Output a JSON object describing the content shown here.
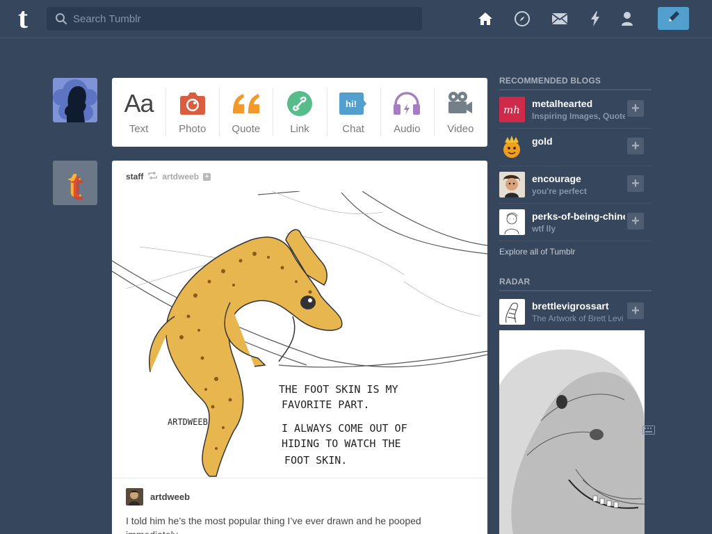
{
  "header": {
    "logo_letter": "t",
    "search_placeholder": "Search Tumblr",
    "nav_icons": [
      "home-icon",
      "explore-compass-icon",
      "inbox-envelope-icon",
      "activity-lightning-icon",
      "account-person-icon"
    ],
    "compose_icon": "pencil-icon"
  },
  "post_types": [
    {
      "label": "Text",
      "icon": "Aa",
      "color": "#444444"
    },
    {
      "label": "Photo",
      "icon": "camera-icon",
      "color": "#d95e40"
    },
    {
      "label": "Quote",
      "icon": "quote-icon",
      "color": "#f2992e"
    },
    {
      "label": "Link",
      "icon": "link-icon",
      "color": "#56bc8a"
    },
    {
      "label": "Chat",
      "icon": "chat-icon",
      "color": "#529ecc",
      "icon_text": "hi!"
    },
    {
      "label": "Audio",
      "icon": "headphones-icon",
      "color": "#a77dc2"
    },
    {
      "label": "Video",
      "icon": "video-camera-icon",
      "color": "#748089"
    }
  ],
  "post": {
    "user": "staff",
    "reblogged_from": "artdweeb",
    "image_caption_lines": [
      "THE FOOT SKIN IS MY",
      "FAVORITE PART.",
      "I ALWAYS COME OUT OF",
      "HIDING TO WATCH THE",
      "FOOT SKIN."
    ],
    "image_signature": "ARTDWEEB",
    "caption_user": "artdweeb",
    "caption_text": "I told him he’s the most popular thing I’ve ever drawn and he pooped immediately."
  },
  "sidebar": {
    "recommended_title": "Recommended Blogs",
    "blogs": [
      {
        "name": "metalhearted",
        "subtitle": "Inspiring Images, Quotes",
        "avatar_text": "mh"
      },
      {
        "name": "gold",
        "subtitle": ""
      },
      {
        "name": "encourage",
        "subtitle": "you're perfect"
      },
      {
        "name": "perks-of-being-chinese",
        "subtitle": "wtf lly"
      }
    ],
    "explore_link": "Explore all of Tumblr",
    "radar_title": "Radar",
    "radar": {
      "name": "brettlevigrossart",
      "subtitle": "The Artwork of Brett Levi Grossart"
    }
  },
  "colors": {
    "background": "#36465d",
    "compose": "#529ecc"
  }
}
